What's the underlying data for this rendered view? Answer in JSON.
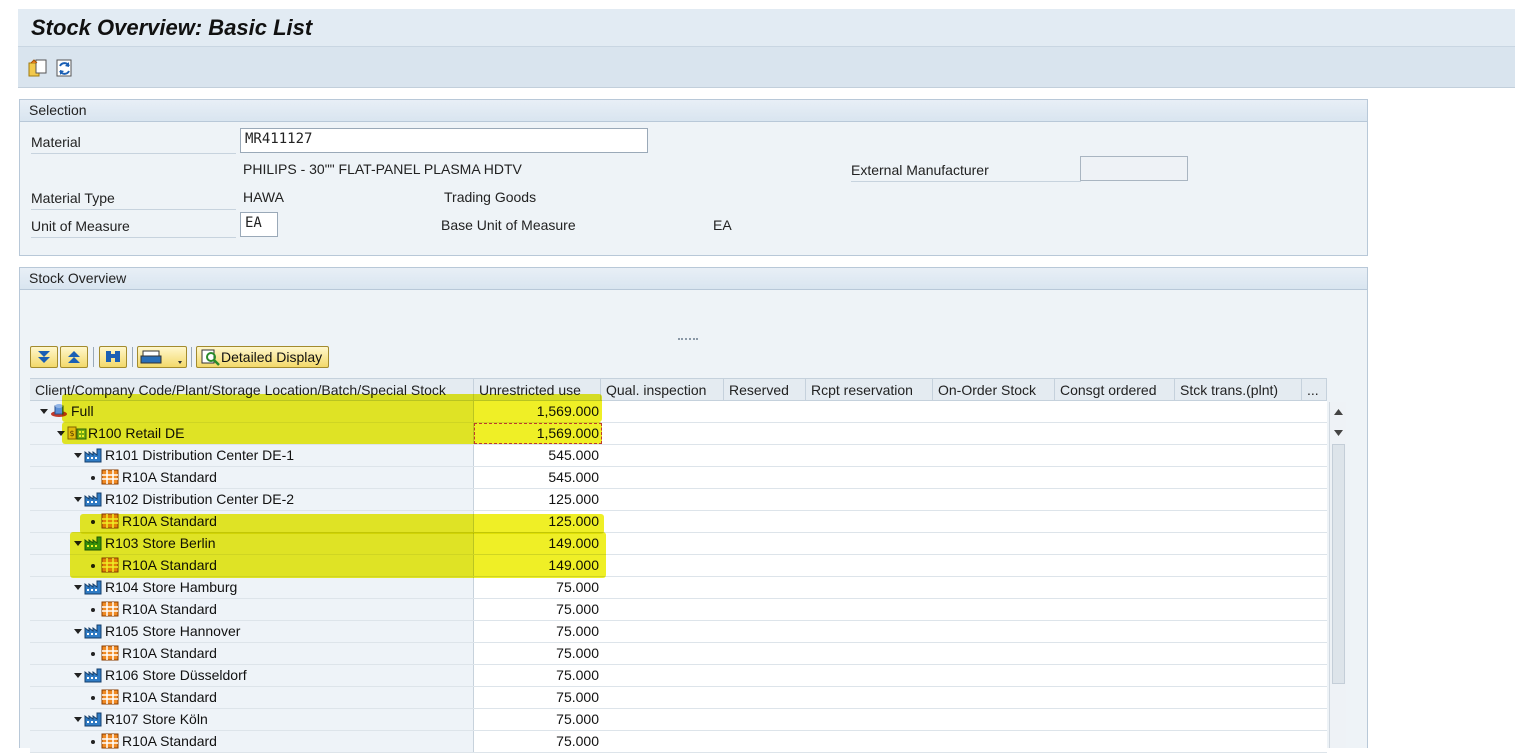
{
  "window": {
    "title": "Stock Overview: Basic List"
  },
  "toolbar": {
    "icons": [
      "copy-selection-icon",
      "refresh-icon"
    ]
  },
  "selection": {
    "header": "Selection",
    "material_label": "Material",
    "material_value": "MR411127",
    "material_desc": "PHILIPS - 30\"\" FLAT-PANEL PLASMA HDTV",
    "ext_mfr_label": "External Manufacturer",
    "ext_mfr_value": "",
    "material_type_label": "Material Type",
    "material_type_value": "HAWA",
    "material_type_desc": "Trading Goods",
    "uom_label": "Unit of Measure",
    "uom_value": "EA",
    "base_uom_label": "Base Unit of Measure",
    "base_uom_value": "EA"
  },
  "stock_overview": {
    "header": "Stock Overview",
    "alv_toolbar": {
      "detailed_display_label": "Detailed Display"
    },
    "columns": [
      "Client/Company Code/Plant/Storage Location/Batch/Special Stock",
      "Unrestricted use",
      "Qual. inspection",
      "Reserved",
      "Rcpt reservation",
      "On-Order Stock",
      "Consgt ordered",
      "Stck trans.(plnt)",
      "..."
    ],
    "rows": [
      {
        "label": "Full",
        "value": "1,569.000",
        "level": 0,
        "icon": "client-icon"
      },
      {
        "label": "R100 Retail DE",
        "value": "1,569.000",
        "level": 1,
        "icon": "company-code-icon"
      },
      {
        "label": "R101 Distribution Center DE-1",
        "value": "545.000",
        "level": 2,
        "icon": "plant-icon"
      },
      {
        "label": "R10A Standard",
        "value": "545.000",
        "level": 3,
        "icon": "storage-location-icon"
      },
      {
        "label": "R102 Distribution Center DE-2",
        "value": "125.000",
        "level": 2,
        "icon": "plant-icon"
      },
      {
        "label": "R10A Standard",
        "value": "125.000",
        "level": 3,
        "icon": "storage-location-icon"
      },
      {
        "label": "R103 Store Berlin",
        "value": "149.000",
        "level": 2,
        "icon": "plant-icon"
      },
      {
        "label": "R10A Standard",
        "value": "149.000",
        "level": 3,
        "icon": "storage-location-icon"
      },
      {
        "label": "R104 Store Hamburg",
        "value": "75.000",
        "level": 2,
        "icon": "plant-icon"
      },
      {
        "label": "R10A Standard",
        "value": "75.000",
        "level": 3,
        "icon": "storage-location-icon"
      },
      {
        "label": "R105 Store Hannover",
        "value": "75.000",
        "level": 2,
        "icon": "plant-icon"
      },
      {
        "label": "R10A Standard",
        "value": "75.000",
        "level": 3,
        "icon": "storage-location-icon"
      },
      {
        "label": "R106 Store Düsseldorf",
        "value": "75.000",
        "level": 2,
        "icon": "plant-icon"
      },
      {
        "label": "R10A Standard",
        "value": "75.000",
        "level": 3,
        "icon": "storage-location-icon"
      },
      {
        "label": "R107 Store Köln",
        "value": "75.000",
        "level": 2,
        "icon": "plant-icon"
      },
      {
        "label": "R10A Standard",
        "value": "75.000",
        "level": 3,
        "icon": "storage-location-icon"
      }
    ]
  },
  "colors": {
    "highlight": "#e6e600",
    "title_bar": "#e2ebf3",
    "group_bg": "#eef3f7"
  }
}
